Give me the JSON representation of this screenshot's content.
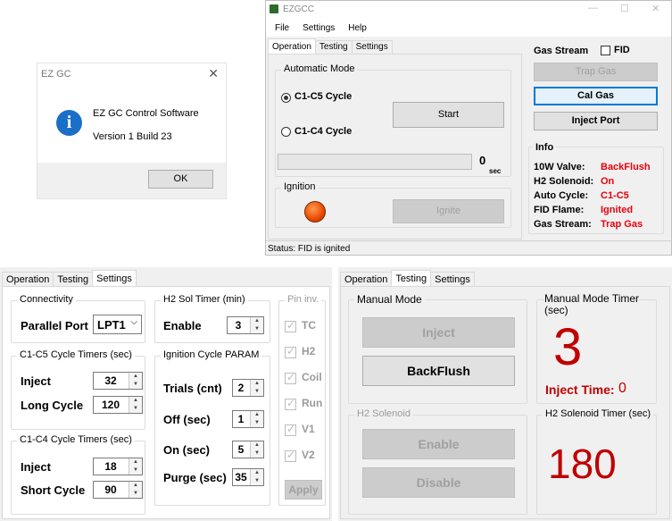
{
  "about": {
    "title": "EZ GC",
    "line1": "EZ GC Control Software",
    "line2": "Version 1 Build 23",
    "ok": "OK",
    "icon": "info-icon",
    "close": "✕"
  },
  "main": {
    "title": "EZGCC",
    "menu": [
      "File",
      "Settings",
      "Help"
    ],
    "tabs": [
      "Operation",
      "Testing",
      "Settings"
    ],
    "auto_mode": "Automatic Mode",
    "c1c5": "C1-C5 Cycle",
    "c1c4": "C1-C4 Cycle",
    "start": "Start",
    "progress_value": "0",
    "progress_unit": "sec",
    "ignition": "Ignition",
    "ignite": "Ignite",
    "gas_stream": "Gas Stream",
    "fid": "FID",
    "trap_gas": "Trap Gas",
    "cal_gas": "Cal Gas",
    "inject_port": "Inject Port",
    "info_title": "Info",
    "info": [
      {
        "k": "10W Valve:",
        "v": "BackFlush"
      },
      {
        "k": "H2 Solenoid:",
        "v": "On"
      },
      {
        "k": "Auto Cycle:",
        "v": "C1-C5"
      },
      {
        "k": "FID Flame:",
        "v": "Ignited"
      },
      {
        "k": "Gas Stream:",
        "v": "Trap Gas"
      }
    ],
    "status": "Status:  FID is ignited",
    "colors": {
      "info_value": "#e8000c",
      "lamp": "#e84a00"
    }
  },
  "settings": {
    "tabs": [
      "Operation",
      "Testing",
      "Settings"
    ],
    "connectivity": "Connectivity",
    "parallel_port": "Parallel Port",
    "port_value": "LPT1",
    "c1c5_timers": "C1-C5 Cycle Timers (sec)",
    "inject": "Inject",
    "inject_val": "32",
    "long_cycle": "Long Cycle",
    "long_val": "120",
    "c1c4_timers": "C1-C4 Cycle Timers (sec)",
    "inject2": "Inject",
    "inject2_val": "18",
    "short_cycle": "Short Cycle",
    "short_val": "90",
    "h2_timer": "H2 Sol Timer (min)",
    "enable": "Enable",
    "enable_val": "3",
    "ign_param": "Ignition Cycle PARAM",
    "trials": "Trials (cnt)",
    "trials_val": "2",
    "off": "Off (sec)",
    "off_val": "1",
    "on": "On (sec)",
    "on_val": "5",
    "purge": "Purge (sec)",
    "purge_val": "35",
    "pin_inv": "Pin inv.",
    "pins": [
      "TC",
      "H2",
      "Coil",
      "Run",
      "V1",
      "V2"
    ],
    "apply": "Apply"
  },
  "testing": {
    "tabs": [
      "Operation",
      "Testing",
      "Settings"
    ],
    "manual_mode": "Manual Mode",
    "inject": "Inject",
    "backflush": "BackFlush",
    "mm_timer": "Manual Mode Timer\n(sec)",
    "mm_value": "3",
    "inject_time_label": "Inject Time:",
    "inject_time_value": "0",
    "h2_solenoid": "H2 Solenoid",
    "enable": "Enable",
    "disable": "Disable",
    "h2_timer": "H2 Solenoid Timer (sec)",
    "h2_value": "180",
    "colors": {
      "big_number": "#c00000"
    }
  }
}
